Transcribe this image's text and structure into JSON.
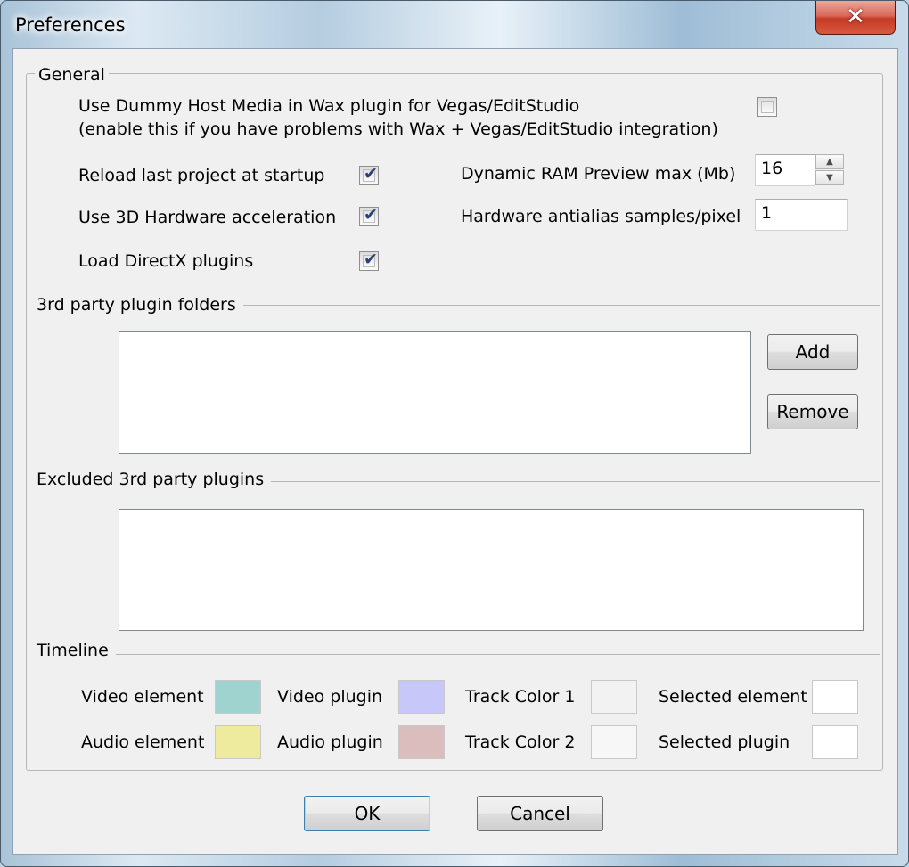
{
  "window": {
    "title": "Preferences",
    "close_label": "✕"
  },
  "general": {
    "legend": "General",
    "dummy_host": {
      "line1": "Use Dummy Host Media in Wax plugin for Vegas/EditStudio",
      "line2": "(enable this if you have problems with Wax + Vegas/EditStudio integration)",
      "checked": false
    },
    "reload_last_project": {
      "label": "Reload last project at startup",
      "checked": true
    },
    "use_3d_hw": {
      "label": "Use 3D Hardware acceleration",
      "checked": true
    },
    "load_directx": {
      "label": "Load DirectX plugins",
      "checked": true
    },
    "ram_preview": {
      "label": "Dynamic RAM Preview max (Mb)",
      "value": "16"
    },
    "antialias": {
      "label": "Hardware antialias samples/pixel",
      "value": "1"
    },
    "check_mark": "✔"
  },
  "plugin_folders": {
    "label": "3rd party plugin folders",
    "add_label": "Add",
    "remove_label": "Remove"
  },
  "excluded_plugins": {
    "label": "Excluded 3rd party plugins"
  },
  "timeline": {
    "label": "Timeline",
    "video_element": {
      "label": "Video element",
      "color": "#9fd3cf"
    },
    "audio_element": {
      "label": "Audio element",
      "color": "#eeea9e"
    },
    "video_plugin": {
      "label": "Video plugin",
      "color": "#c7c7f9"
    },
    "audio_plugin": {
      "label": "Audio plugin",
      "color": "#dcbdbd"
    },
    "track_color_1": {
      "label": "Track Color 1",
      "color": "#f2f2f2"
    },
    "track_color_2": {
      "label": "Track Color 2",
      "color": "#f7f7f7"
    },
    "selected_element": {
      "label": "Selected element",
      "color": "#ffffff"
    },
    "selected_plugin": {
      "label": "Selected plugin",
      "color": "#ffffff"
    }
  },
  "buttons": {
    "ok_label": "OK",
    "cancel_label": "Cancel"
  }
}
